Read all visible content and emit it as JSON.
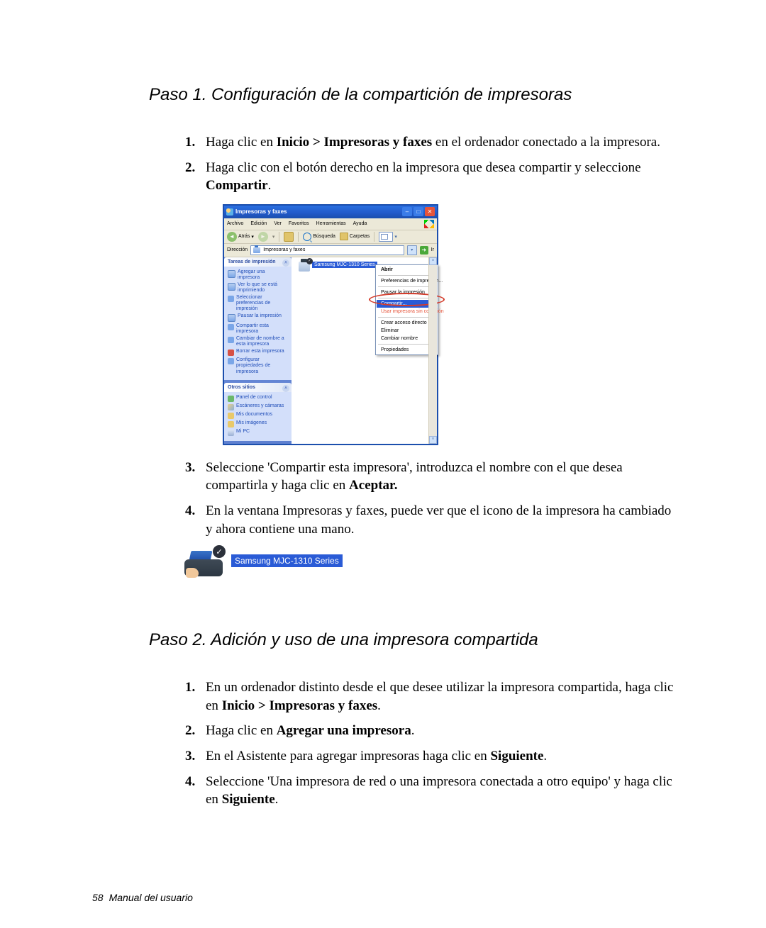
{
  "step1": {
    "heading": "Paso 1. Configuración de la compartición de impresoras",
    "items": {
      "1": {
        "pre": "Haga clic en ",
        "b": "Inicio > Impresoras y faxes",
        "post": " en el ordenador conectado a la impresora."
      },
      "2": {
        "pre": "Haga clic con el botón derecho en la impresora que desea compartir y seleccione ",
        "b": "Compartir",
        "post": "."
      },
      "3": {
        "pre": "Seleccione 'Compartir esta impresora', introduzca el nombre con el que desea compartirla y haga clic en ",
        "b": "Aceptar.",
        "post": ""
      },
      "4": {
        "text": "En la ventana Impresoras y faxes, puede ver que el icono de la impresora ha cambiado y ahora contiene una mano."
      }
    }
  },
  "step2": {
    "heading": "Paso 2. Adición y uso de una impresora compartida",
    "items": {
      "1": {
        "pre": "En un ordenador distinto desde el que desee utilizar la impresora compartida, haga clic en ",
        "b": "Inicio > Impresoras y faxes",
        "post": "."
      },
      "2": {
        "pre": "Haga clic en ",
        "b": "Agregar una impresora",
        "post": "."
      },
      "3": {
        "pre": "En el Asistente para agregar impresoras haga clic en ",
        "b": "Siguiente",
        "post": "."
      },
      "4": {
        "pre": "Seleccione 'Una impresora de red o una impresora conectada a otro equipo' y haga clic en ",
        "b": "Siguiente",
        "post": "."
      }
    }
  },
  "xp": {
    "title": "Impresoras y faxes",
    "menus": {
      "archivo": "Archivo",
      "edicion": "Edición",
      "ver": "Ver",
      "favoritos": "Favoritos",
      "herramientas": "Herramientas",
      "ayuda": "Ayuda"
    },
    "toolbar": {
      "atras": "Atrás",
      "busqueda": "Búsqueda",
      "carpetas": "Carpetas"
    },
    "address": {
      "label": "Dirección",
      "value": "Impresoras y faxes",
      "go": "Ir"
    },
    "panel1": {
      "title": "Tareas de impresión",
      "items": {
        "add": "Agregar una impresora",
        "see": "Ver lo que se está imprimiendo",
        "pref": "Seleccionar preferencias de impresión",
        "pause": "Pausar la impresión",
        "share": "Compartir esta impresora",
        "rename": "Cambiar de nombre a esta impresora",
        "delete": "Borrar esta impresora",
        "props": "Configurar propiedades de impresora"
      }
    },
    "panel2": {
      "title": "Otros sitios",
      "items": {
        "cp": "Panel de control",
        "scan": "Escáneres y cámaras",
        "docs": "Mis documentos",
        "img": "Mis imágenes",
        "pc": "Mi PC"
      }
    },
    "printer_label": "Samsung MJC-1310 Series",
    "ctx": {
      "open": "Abrir",
      "pref": "Preferencias de impresión...",
      "pause": "Pausar la impresión",
      "share": "Compartir...",
      "useoff": "Usar impresora sin conexión",
      "shortcut": "Crear acceso directo",
      "delete": "Eliminar",
      "rename": "Cambiar nombre",
      "props": "Propiedades"
    }
  },
  "small_label": "Samsung MJC-1310 Series",
  "footer": {
    "page": "58",
    "title": "Manual del usuario"
  }
}
